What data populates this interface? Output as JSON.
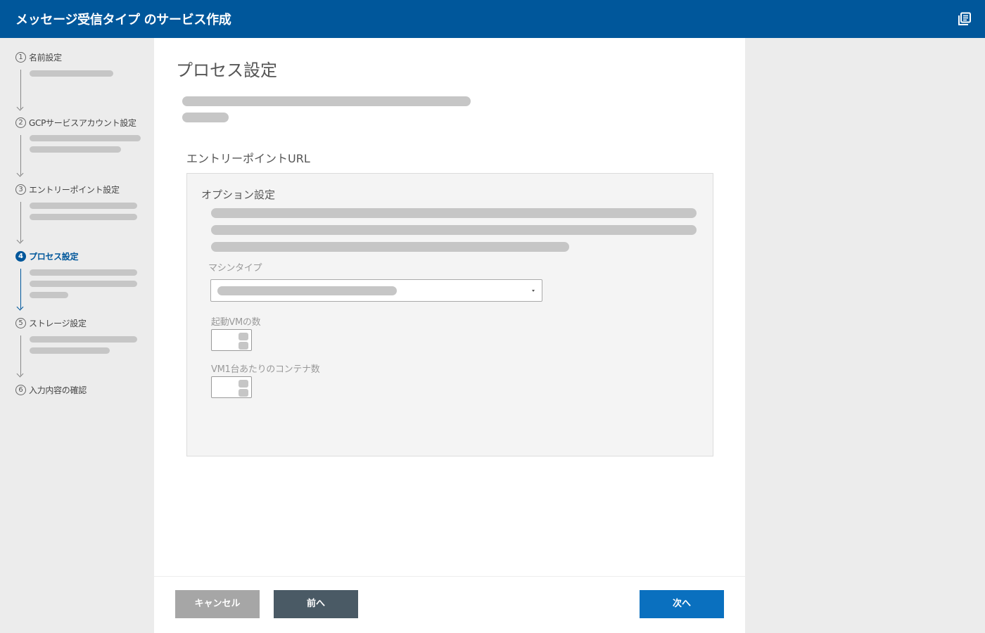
{
  "header": {
    "title": "メッセージ受信タイプ のサービス作成",
    "icon": "library-books-icon"
  },
  "sidebar": {
    "steps": [
      {
        "num": "1",
        "label": "名前設定"
      },
      {
        "num": "2",
        "label": "GCPサービスアカウント設定"
      },
      {
        "num": "3",
        "label": "エントリーポイント設定"
      },
      {
        "num": "4",
        "label": "プロセス設定"
      },
      {
        "num": "5",
        "label": "ストレージ設定"
      },
      {
        "num": "6",
        "label": "入力内容の確認"
      }
    ],
    "active_step": 4
  },
  "main": {
    "title": "プロセス設定",
    "section_label": "エントリーポイントURL",
    "options": {
      "title": "オプション設定",
      "machine_type_label": "マシンタイプ",
      "vm_count_label": "起動VMの数",
      "containers_per_vm_label": "VM1台あたりのコンテナ数"
    }
  },
  "footer": {
    "cancel_label": "キャンセル",
    "prev_label": "前へ",
    "next_label": "次へ"
  },
  "colors": {
    "header_bg": "#00579b",
    "active_step": "#00579b",
    "next_button": "#0a70bf",
    "prev_button": "#4a5a65",
    "cancel_button": "#a6a6a6",
    "placeholder": "#c6c6c6"
  }
}
